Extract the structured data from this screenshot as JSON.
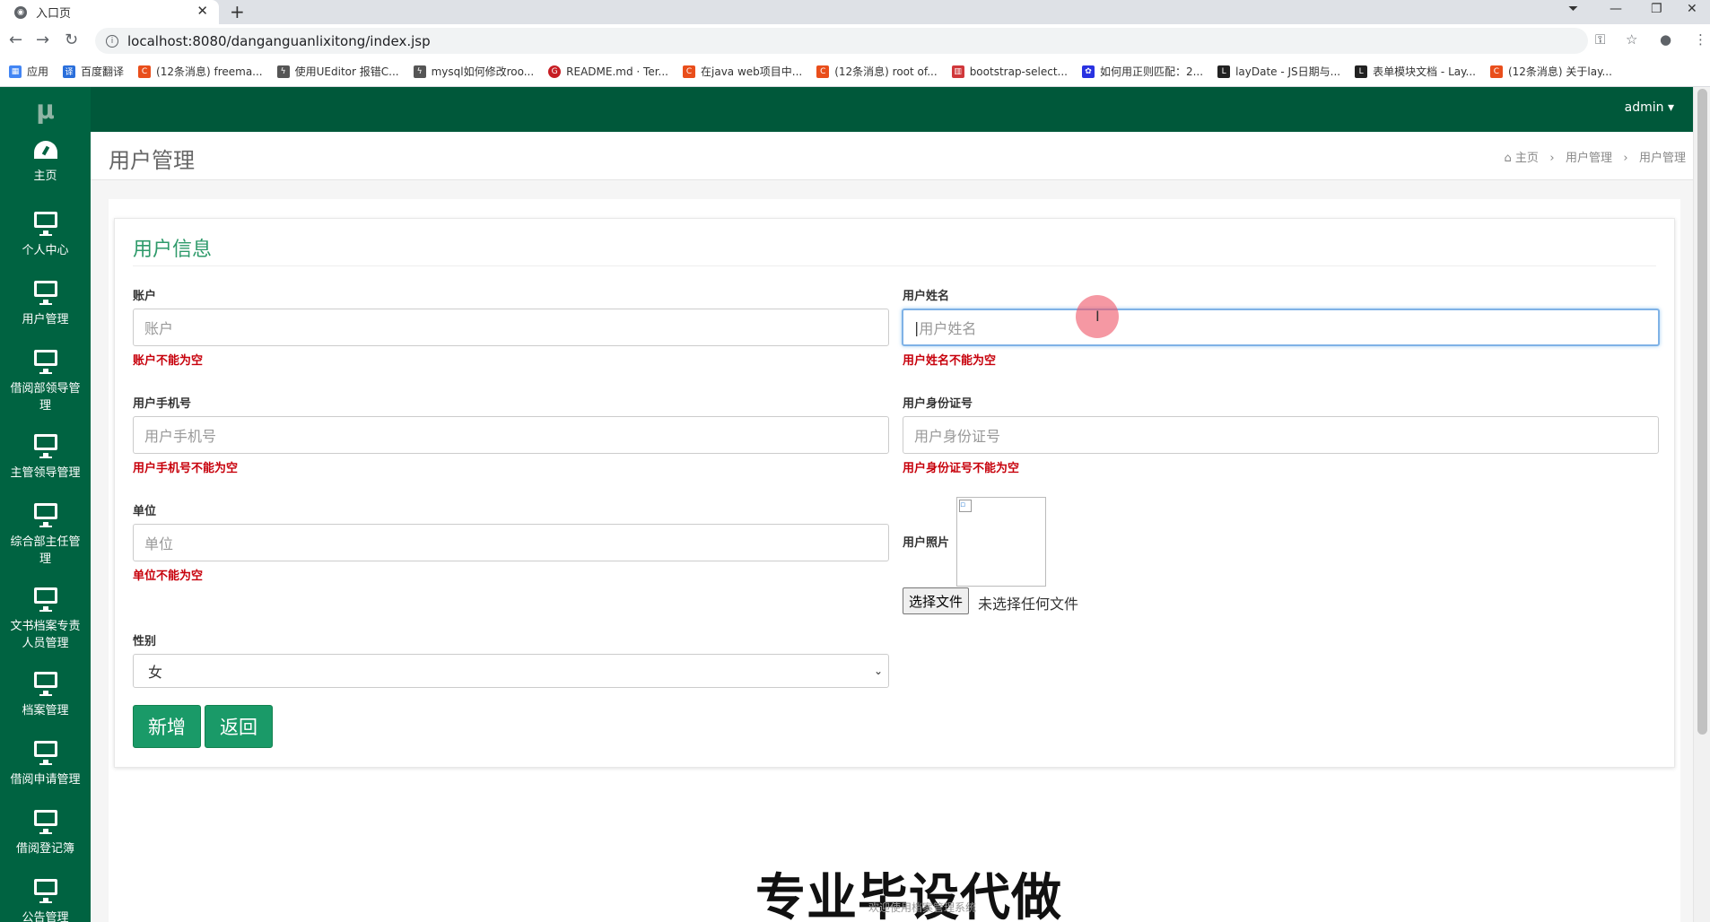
{
  "browser": {
    "tab_title": "入口页",
    "tab_close": "✕",
    "new_tab": "+",
    "url": "localhost:8080/danganguanlixitong/index.jsp",
    "bookmarks": [
      "应用",
      "百度翻译",
      "(12条消息) freema...",
      "使用UEditor 报错C...",
      "mysql如何修改roo...",
      "README.md · Ter...",
      "在java web项目中...",
      "(12条消息) root of...",
      "bootstrap-select...",
      "如何用正则匹配：2...",
      "layDate - JS日期与...",
      "表单模块文档 - Lay...",
      "(12条消息) 关于lay..."
    ]
  },
  "app": {
    "logo": "μ",
    "user_menu": "admin ▾",
    "sidebar": [
      {
        "label": "主页",
        "icon": "dashboard-icon"
      },
      {
        "label": "个人中心",
        "icon": "monitor-icon"
      },
      {
        "label": "用户管理",
        "icon": "monitor-icon"
      },
      {
        "label": "借阅部领导管理",
        "icon": "monitor-icon"
      },
      {
        "label": "主管领导管理",
        "icon": "monitor-icon"
      },
      {
        "label": "综合部主任管理",
        "icon": "monitor-icon"
      },
      {
        "label": "文书档案专责人员管理",
        "icon": "monitor-icon"
      },
      {
        "label": "档案管理",
        "icon": "monitor-icon"
      },
      {
        "label": "借阅申请管理",
        "icon": "monitor-icon"
      },
      {
        "label": "借阅登记簿",
        "icon": "monitor-icon"
      },
      {
        "label": "公告管理",
        "icon": "monitor-icon"
      }
    ],
    "page_title": "用户管理",
    "breadcrumb": {
      "home": "主页",
      "sep": "›",
      "level1": "用户管理",
      "level2": "用户管理"
    }
  },
  "form": {
    "title": "用户信息",
    "account": {
      "label": "账户",
      "placeholder": "账户",
      "error": "账户不能为空"
    },
    "name": {
      "label": "用户姓名",
      "placeholder": "用户姓名",
      "error": "用户姓名不能为空"
    },
    "phone": {
      "label": "用户手机号",
      "placeholder": "用户手机号",
      "error": "用户手机号不能为空"
    },
    "idcard": {
      "label": "用户身份证号",
      "placeholder": "用户身份证号",
      "error": "用户身份证号不能为空"
    },
    "unit": {
      "label": "单位",
      "placeholder": "单位",
      "error": "单位不能为空"
    },
    "photo": {
      "label": "用户照片",
      "choose": "选择文件",
      "no_file": "未选择任何文件"
    },
    "gender": {
      "label": "性别",
      "selected": "女"
    },
    "add_button": "新增",
    "back_button": "返回"
  },
  "watermark": {
    "main": "专业毕设代做",
    "sub": "欢迎使用档案管理系统"
  }
}
